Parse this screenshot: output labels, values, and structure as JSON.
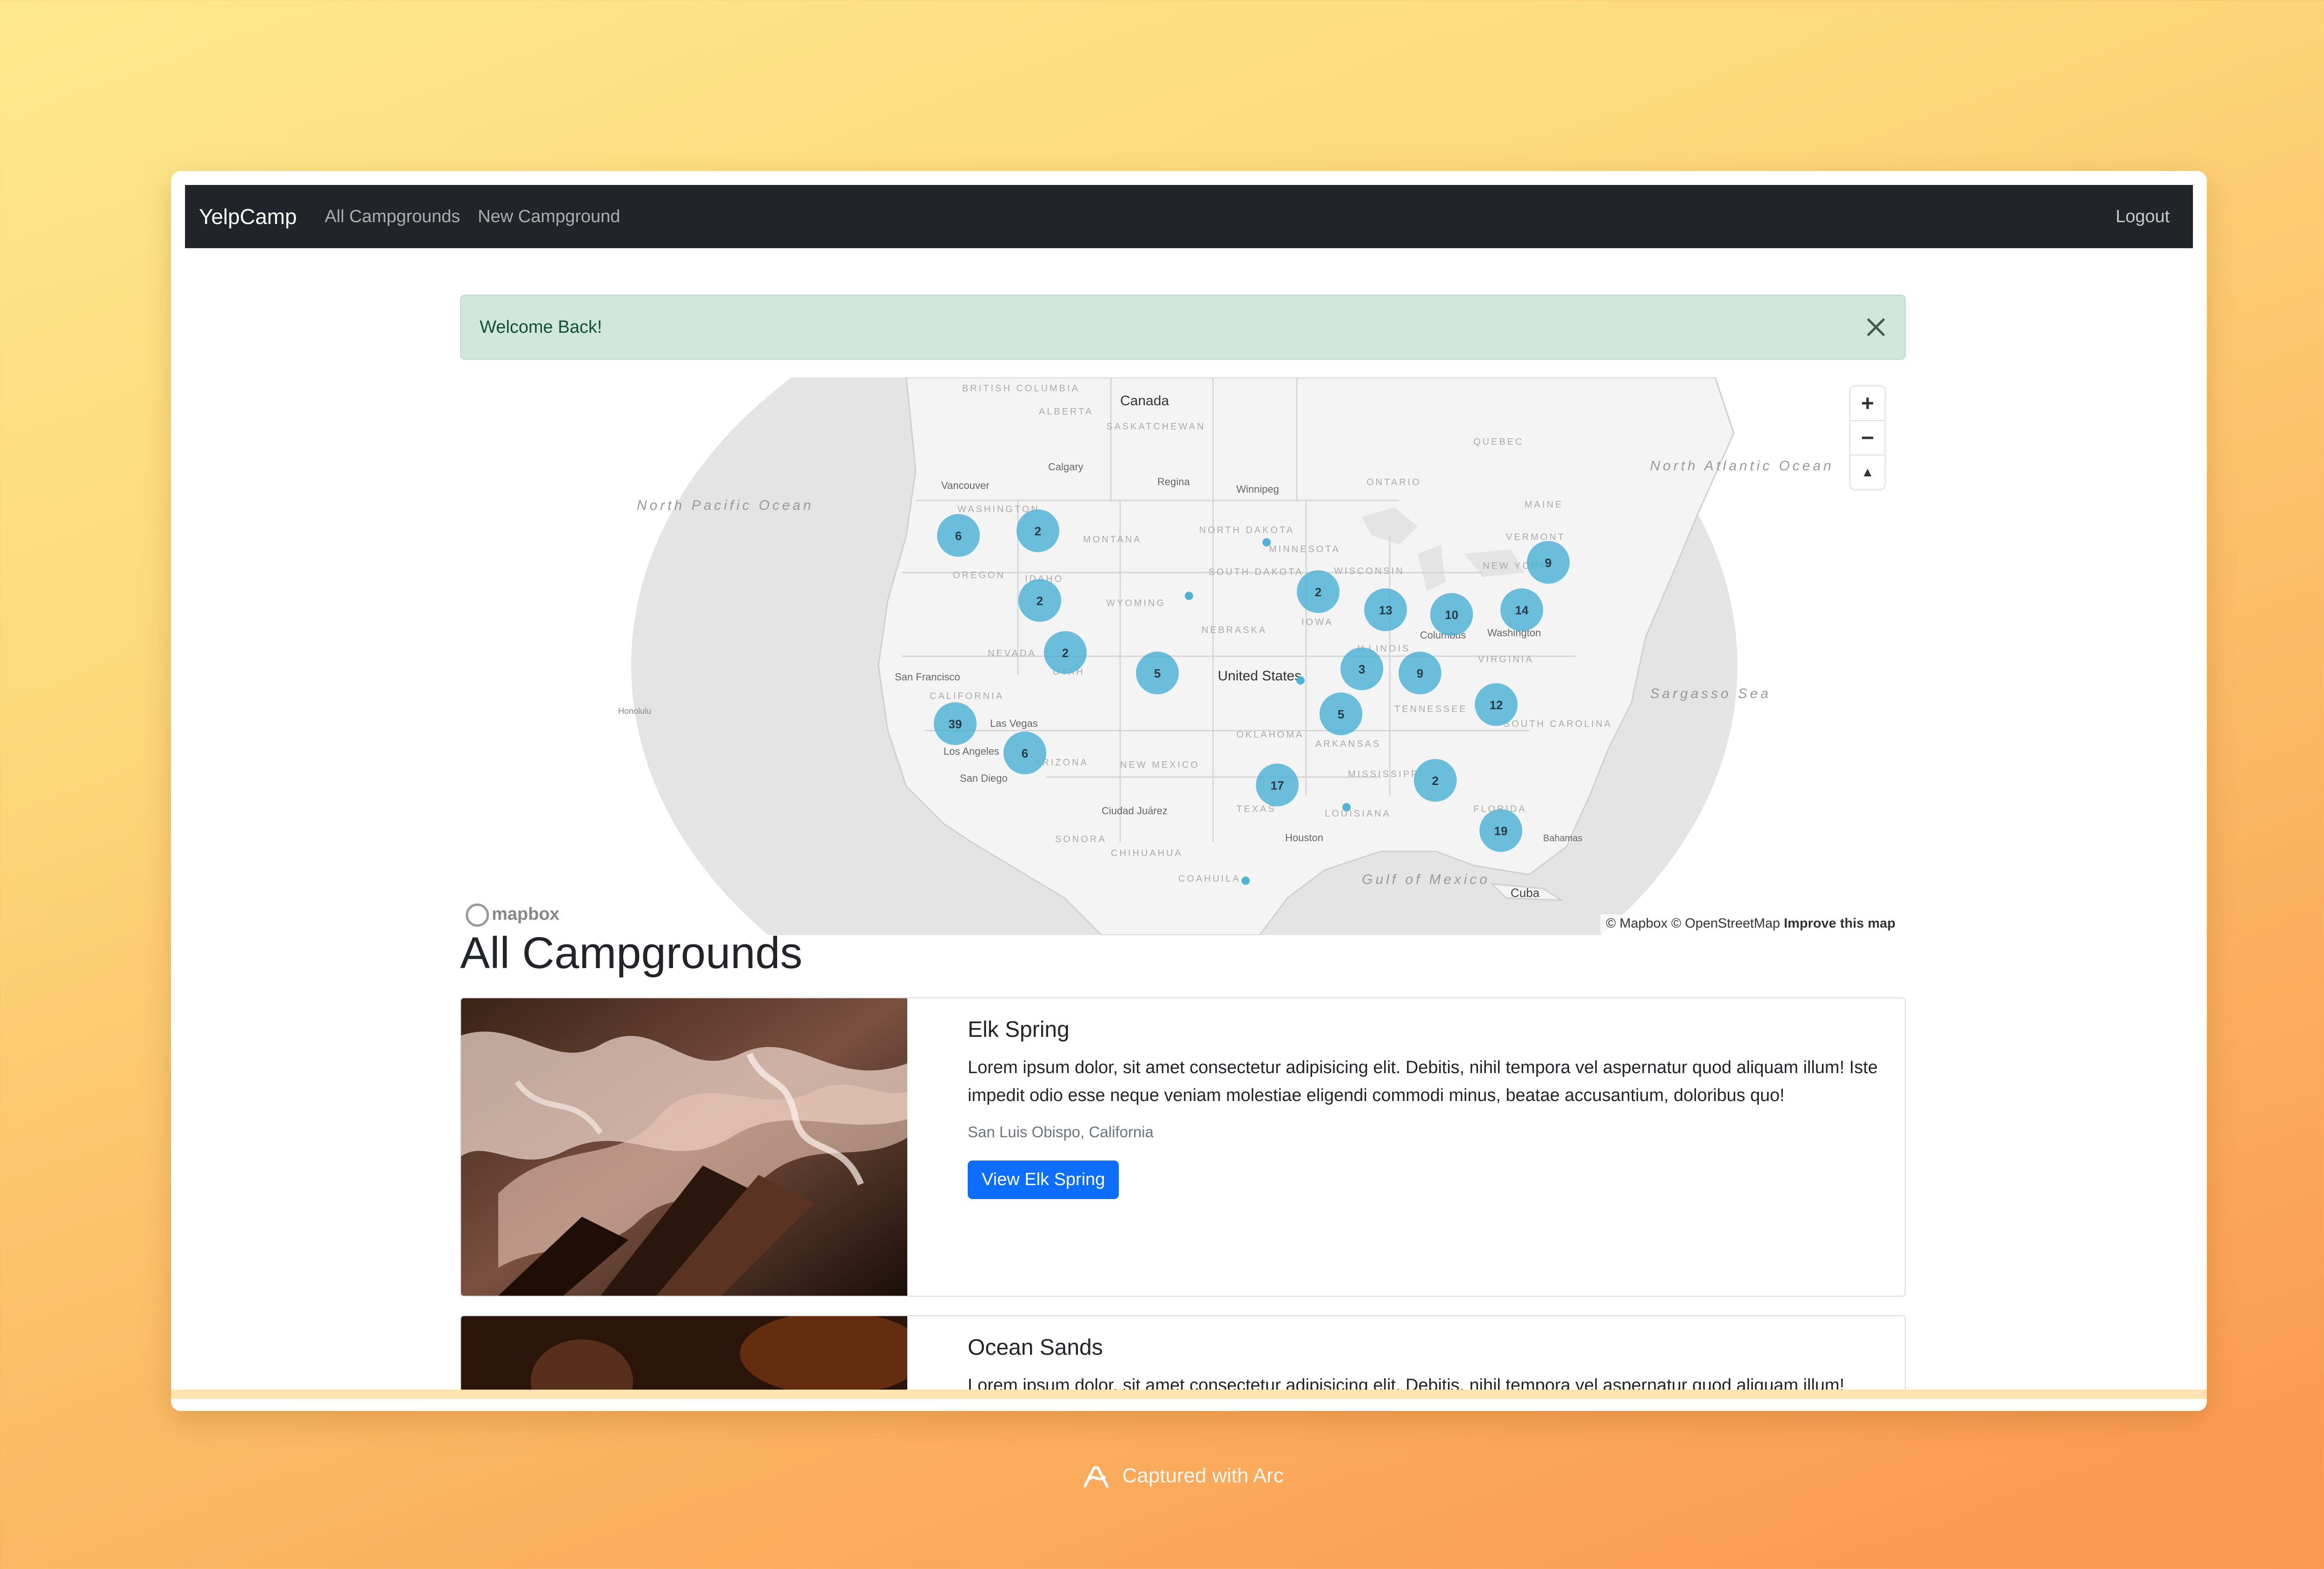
{
  "navbar": {
    "brand": "YelpCamp",
    "links": [
      "All Campgrounds",
      "New Campground"
    ],
    "logout": "Logout"
  },
  "alert": {
    "message": "Welcome Back!"
  },
  "map": {
    "places": [
      {
        "label": "Canada"
      },
      {
        "label": "United States"
      },
      {
        "label": "Vancouver"
      },
      {
        "label": "Calgary"
      },
      {
        "label": "Regina"
      },
      {
        "label": "Winnipeg"
      },
      {
        "label": "San Francisco"
      },
      {
        "label": "Las Vegas"
      },
      {
        "label": "Los Angeles"
      },
      {
        "label": "San Diego"
      },
      {
        "label": "Ciudad Juárez"
      },
      {
        "label": "Houston"
      },
      {
        "label": "Columbus"
      },
      {
        "label": "Washington"
      },
      {
        "label": "Cuba"
      },
      {
        "label": "Bahamas"
      },
      {
        "label": "Honolulu"
      },
      {
        "label": "North Pacific Ocean"
      },
      {
        "label": "North Atlantic Ocean"
      },
      {
        "label": "Sargasso Sea"
      },
      {
        "label": "Gulf of Mexico"
      },
      {
        "label": "WASHINGTON"
      },
      {
        "label": "MONTANA"
      },
      {
        "label": "OREGON"
      },
      {
        "label": "IDAHO"
      },
      {
        "label": "WYOMING"
      },
      {
        "label": "NEVADA"
      },
      {
        "label": "UTAH"
      },
      {
        "label": "CALIFORNIA"
      },
      {
        "label": "ARIZONA"
      },
      {
        "label": "NEW MEXICO"
      },
      {
        "label": "TEXAS"
      },
      {
        "label": "OKLAHOMA"
      },
      {
        "label": "NEBRASKA"
      },
      {
        "label": "SOUTH DAKOTA"
      },
      {
        "label": "NORTH DAKOTA"
      },
      {
        "label": "MINNESOTA"
      },
      {
        "label": "IOWA"
      },
      {
        "label": "WISCONSIN"
      },
      {
        "label": "ILLINOIS"
      },
      {
        "label": "TENNESSEE"
      },
      {
        "label": "ARKANSAS"
      },
      {
        "label": "MISSISSIPPI"
      },
      {
        "label": "LOUISIANA"
      },
      {
        "label": "VIRGINIA"
      },
      {
        "label": "SOUTH CAROLINA"
      },
      {
        "label": "FLORIDA"
      },
      {
        "label": "NEW YORK"
      },
      {
        "label": "MAINE"
      },
      {
        "label": "VERMONT"
      },
      {
        "label": "ONTARIO"
      },
      {
        "label": "QUEBEC"
      },
      {
        "label": "ALBERTA"
      },
      {
        "label": "SASKATCHEWAN"
      },
      {
        "label": "BRITISH COLUMBIA"
      },
      {
        "label": "SONORA"
      },
      {
        "label": "CHIHUAHUA"
      },
      {
        "label": "COAHUILA"
      }
    ],
    "clusters": [
      {
        "count": "6"
      },
      {
        "count": "2"
      },
      {
        "count": "2"
      },
      {
        "count": "2"
      },
      {
        "count": "5"
      },
      {
        "count": "39"
      },
      {
        "count": "6"
      },
      {
        "count": "17"
      },
      {
        "count": "2"
      },
      {
        "count": "13"
      },
      {
        "count": "10"
      },
      {
        "count": "14"
      },
      {
        "count": "9"
      },
      {
        "count": "3"
      },
      {
        "count": "9"
      },
      {
        "count": "5"
      },
      {
        "count": "12"
      },
      {
        "count": "2"
      },
      {
        "count": "19"
      }
    ],
    "controls": {
      "zoom_in": "+",
      "zoom_out": "−",
      "compass": "▲"
    },
    "logo": "mapbox",
    "attribution": "© Mapbox © OpenStreetMap",
    "improve": "Improve this map"
  },
  "page_title": "All Campgrounds",
  "campgrounds": [
    {
      "title": "Elk Spring",
      "description": "Lorem ipsum dolor, sit amet consectetur adipisicing elit. Debitis, nihil tempora vel aspernatur quod aliquam illum! Iste impedit odio esse neque veniam molestiae eligendi commodi minus, beatae accusantium, doloribus quo!",
      "location": "San Luis Obispo, California",
      "button": "View Elk Spring"
    },
    {
      "title": "Ocean Sands",
      "description": "Lorem ipsum dolor, sit amet consectetur adipisicing elit. Debitis, nihil tempora vel aspernatur quod aliquam illum!"
    }
  ],
  "footer": {
    "text": "Captured with Arc"
  },
  "colors": {
    "navbar": "#212529",
    "alert_bg": "#d1e7dd",
    "button": "#0d6efd",
    "cluster": "#51b3d6"
  }
}
